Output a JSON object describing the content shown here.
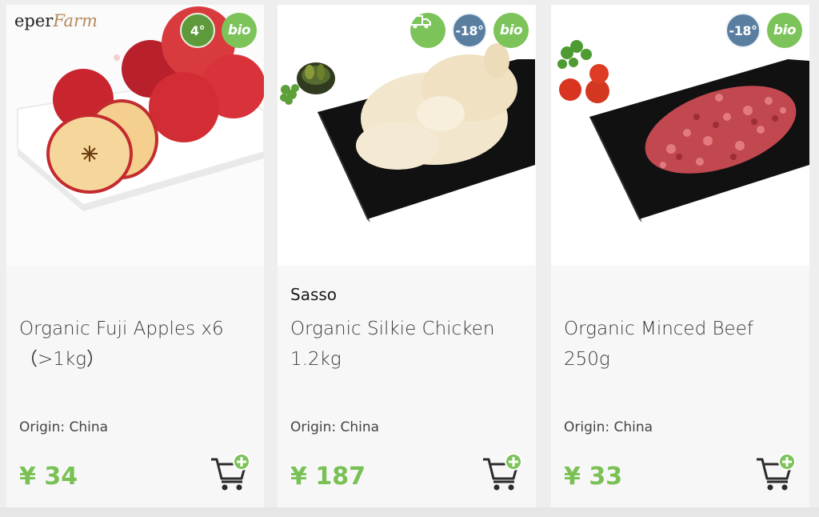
{
  "logo": {
    "text_1": "eper",
    "text_2": "Farm"
  },
  "products": [
    {
      "badges": [
        {
          "type": "temp",
          "label": "4°",
          "icon": "snowflake-icon"
        },
        {
          "type": "bio",
          "label": "bio"
        }
      ],
      "brand": "",
      "title": "Organic Fuji Apples x6 （>1kg）",
      "origin": "Origin: China",
      "price": "¥ 34",
      "cart_icon": "add-to-cart-icon"
    },
    {
      "badges": [
        {
          "type": "delivery",
          "label": "",
          "icon": "delivery-truck-icon"
        },
        {
          "type": "frozen",
          "label": "-18°",
          "icon": "snowflake-icon"
        },
        {
          "type": "bio",
          "label": "bio"
        }
      ],
      "brand": "Sasso",
      "title": "Organic Silkie Chicken 1.2kg",
      "origin": "Origin: China",
      "price": "¥ 187",
      "cart_icon": "add-to-cart-icon"
    },
    {
      "badges": [
        {
          "type": "frozen",
          "label": "-18°",
          "icon": "snowflake-icon"
        },
        {
          "type": "bio",
          "label": "bio"
        }
      ],
      "brand": "",
      "title": "Organic Minced Beef 250g",
      "origin": "Origin: China",
      "price": "¥ 33",
      "cart_icon": "add-to-cart-icon"
    }
  ],
  "colors": {
    "price_green": "#79c154",
    "bio_green": "#7cc35a",
    "frozen_blue": "#5a7ea0"
  }
}
